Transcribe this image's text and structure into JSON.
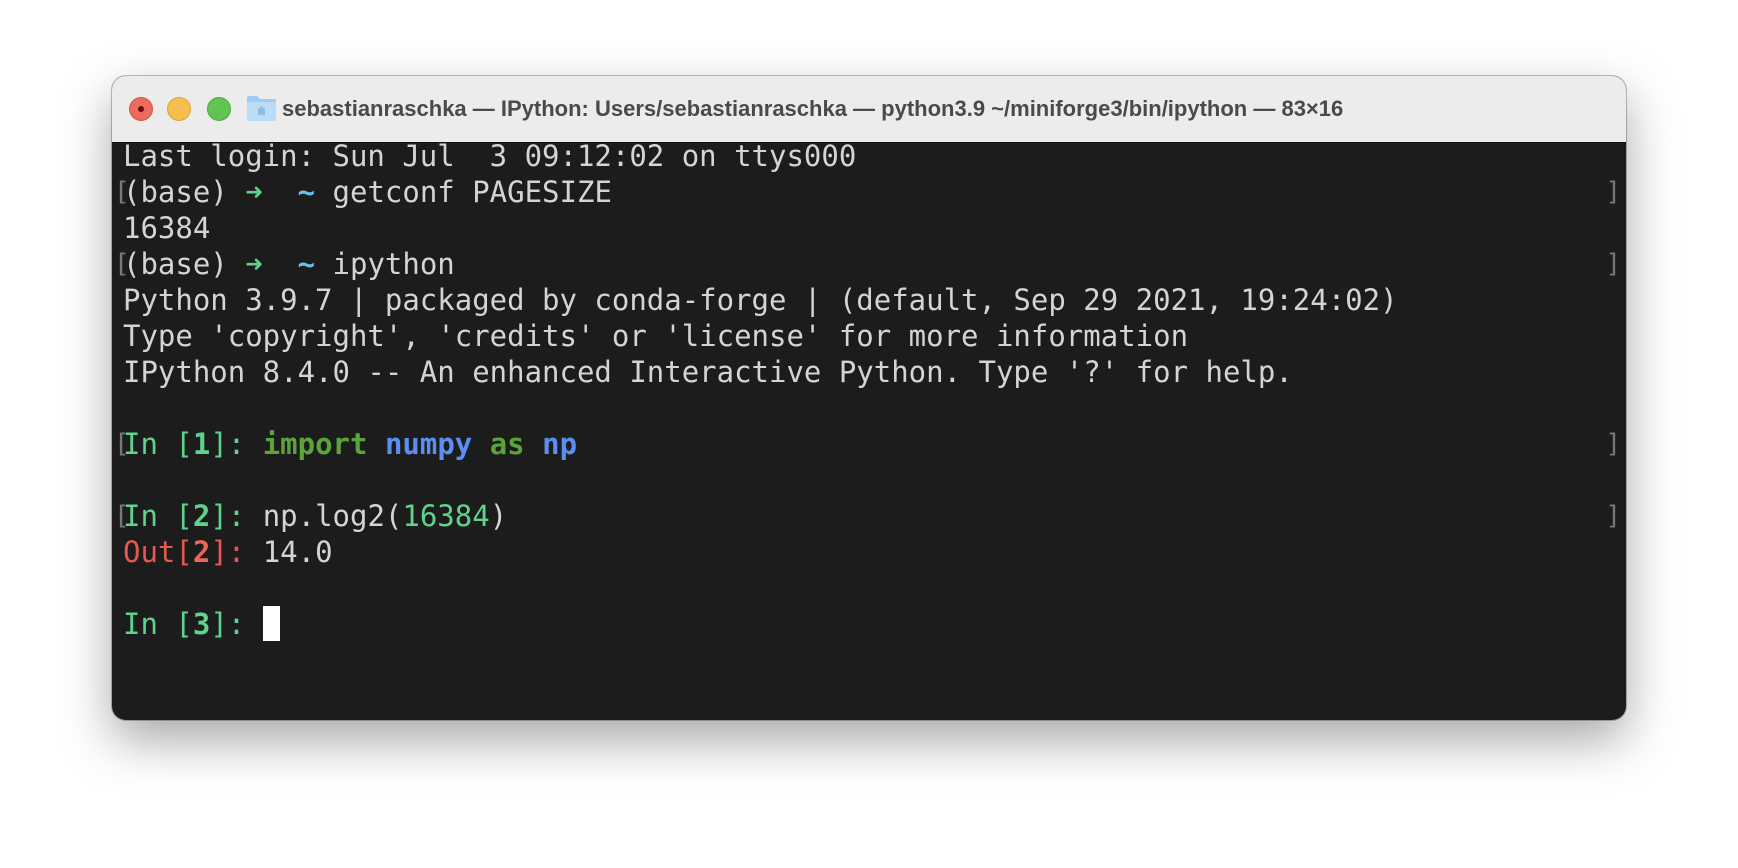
{
  "window": {
    "title": "sebastianraschka — IPython: Users/sebastianraschka — python3.9 ~/miniforge3/bin/ipython — 83×16"
  },
  "terminal": {
    "last_login": "Last login: Sun Jul  3 09:12:02 on ttys000",
    "prompt_env": "(base) ",
    "prompt_arrow": "➜",
    "prompt_tilde": "~",
    "cmd1": "getconf PAGESIZE",
    "out1": "16384",
    "cmd2": "ipython",
    "banner1": "Python 3.9.7 | packaged by conda-forge | (default, Sep 29 2021, 19:24:02)",
    "banner2": "Type 'copyright', 'credits' or 'license' for more information",
    "banner3": "IPython 8.4.0 -- An enhanced Interactive Python. Type '?' for help.",
    "in_label": "In [",
    "out_label": "Out[",
    "close_bracket": "]",
    "colon": ": ",
    "cell1": {
      "n": "1",
      "kw1": "import",
      "mod": "numpy",
      "kw2": "as",
      "alias": "np"
    },
    "cell2": {
      "n": "2",
      "call_pre": "np.log2(",
      "arg": "16384",
      "call_post": ")",
      "out": "14.0"
    },
    "cell3": {
      "n": "3"
    }
  },
  "colors": {
    "prompt_green": "#5fd38c",
    "keyword_green": "#5aa43a",
    "name_blue": "#5b8ef0",
    "out_red": "#e5584f",
    "tilde_cyan": "#5ec4f0"
  }
}
